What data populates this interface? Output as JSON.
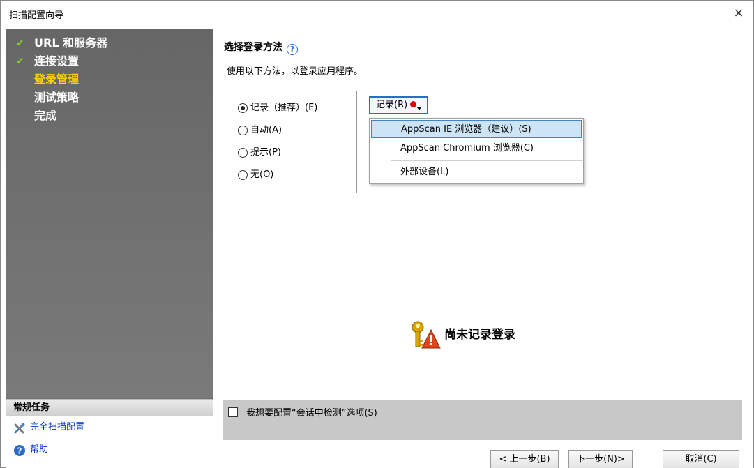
{
  "window": {
    "title": "扫描配置向导",
    "close": "×"
  },
  "sidebar": {
    "steps": [
      {
        "label": "URL 和服务器",
        "done": true
      },
      {
        "label": "连接设置",
        "done": true
      },
      {
        "label": "登录管理",
        "current": true
      },
      {
        "label": "测试策略"
      },
      {
        "label": "完成"
      }
    ],
    "tasks_header": "常规任务",
    "tasks": [
      {
        "label": "完全扫描配置",
        "icon": "tools-icon"
      },
      {
        "label": "帮助",
        "icon": "help-circle-icon"
      }
    ]
  },
  "main": {
    "section_title": "选择登录方法",
    "section_desc": "使用以下方法，以登录应用程序。",
    "radios": [
      {
        "label": "记录（推荐）(E)",
        "checked": true
      },
      {
        "label": "自动(A)",
        "checked": false
      },
      {
        "label": "提示(P)",
        "checked": false
      },
      {
        "label": "无(O)",
        "checked": false
      }
    ],
    "record_button": "记录(R)",
    "menu": [
      {
        "label": "AppScan IE 浏览器（建议）(S)",
        "highlighted": true
      },
      {
        "label": "AppScan Chromium 浏览器(C)"
      },
      {
        "label": "外部设备(L)"
      }
    ],
    "status_text": "尚未记录登录",
    "session_option": "我想要配置“会话中检测”选项(S)",
    "buttons": {
      "prev": "< 上一步(B)",
      "next": "下一步(N)>",
      "cancel": "取消(C)"
    }
  },
  "colors": {
    "current_step": "#ffd400",
    "check": "#7fd12a",
    "menu_highlight": "#cde4f7",
    "record_dot": "#d40000"
  }
}
